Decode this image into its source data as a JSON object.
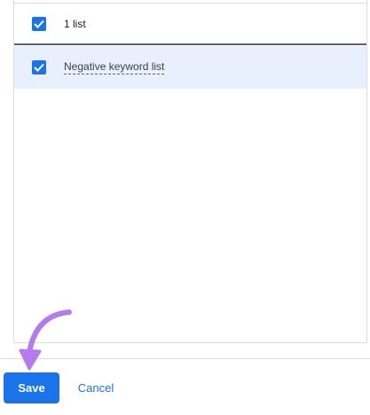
{
  "list_panel": {
    "header": {
      "checked": true,
      "label": "1 list"
    },
    "items": [
      {
        "checked": true,
        "label": "Negative keyword list"
      }
    ]
  },
  "footer": {
    "save_label": "Save",
    "cancel_label": "Cancel"
  },
  "annotation": {
    "icon": "curved-arrow-icon",
    "color": "#b57bed"
  },
  "colors": {
    "accent": "#1a73e8",
    "selected_row": "#e8f0fe",
    "divider": "#dadce0"
  }
}
